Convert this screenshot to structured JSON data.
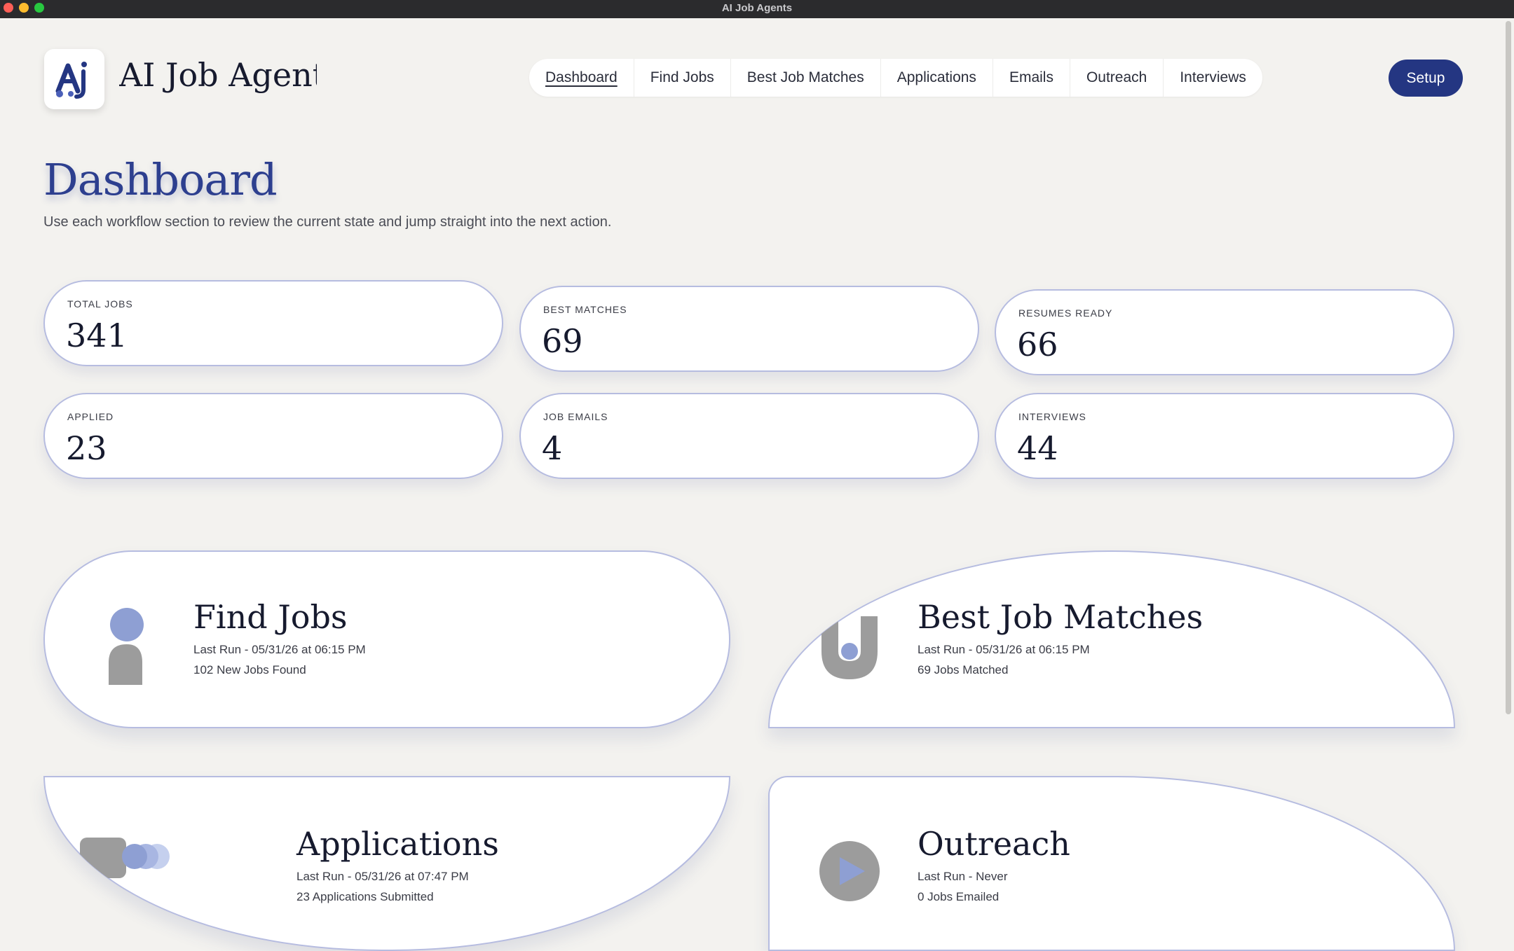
{
  "window": {
    "title": "AI Job Agents"
  },
  "brand": {
    "name": "AI Job Agents"
  },
  "nav": {
    "items": [
      "Dashboard",
      "Find Jobs",
      "Best Job Matches",
      "Applications",
      "Emails",
      "Outreach",
      "Interviews"
    ],
    "active": "Dashboard"
  },
  "setup_label": "Setup",
  "page": {
    "title": "Dashboard",
    "subtitle": "Use each workflow section to review the current state and jump straight into the next action."
  },
  "stats": [
    {
      "label": "TOTAL JOBS",
      "value": "341"
    },
    {
      "label": "BEST MATCHES",
      "value": "69"
    },
    {
      "label": "RESUMES READY",
      "value": "66"
    },
    {
      "label": "APPLIED",
      "value": "23"
    },
    {
      "label": "JOB EMAILS",
      "value": "4"
    },
    {
      "label": "INTERVIEWS",
      "value": "44"
    }
  ],
  "cards": [
    {
      "title": "Find Jobs",
      "last_run": "Last Run - 05/31/26 at 06:15 PM",
      "summary": "102 New Jobs Found",
      "icon": "person-figure-icon"
    },
    {
      "title": "Best Job Matches",
      "last_run": "Last Run - 05/31/26 at 06:15 PM",
      "summary": "69 Jobs Matched",
      "icon": "magnet-icon"
    },
    {
      "title": "Applications",
      "last_run": "Last Run - 05/31/26 at 07:47 PM",
      "summary": "23 Applications Submitted",
      "icon": "card-stack-icon"
    },
    {
      "title": "Outreach",
      "last_run": "Last Run - Never",
      "summary": "0 Jobs Emailed",
      "icon": "play-circle-icon"
    }
  ],
  "colors": {
    "accent": "#243682",
    "title_blue": "#2d3f8f",
    "card_border": "#b6bce0",
    "background": "#f3f2ef"
  }
}
